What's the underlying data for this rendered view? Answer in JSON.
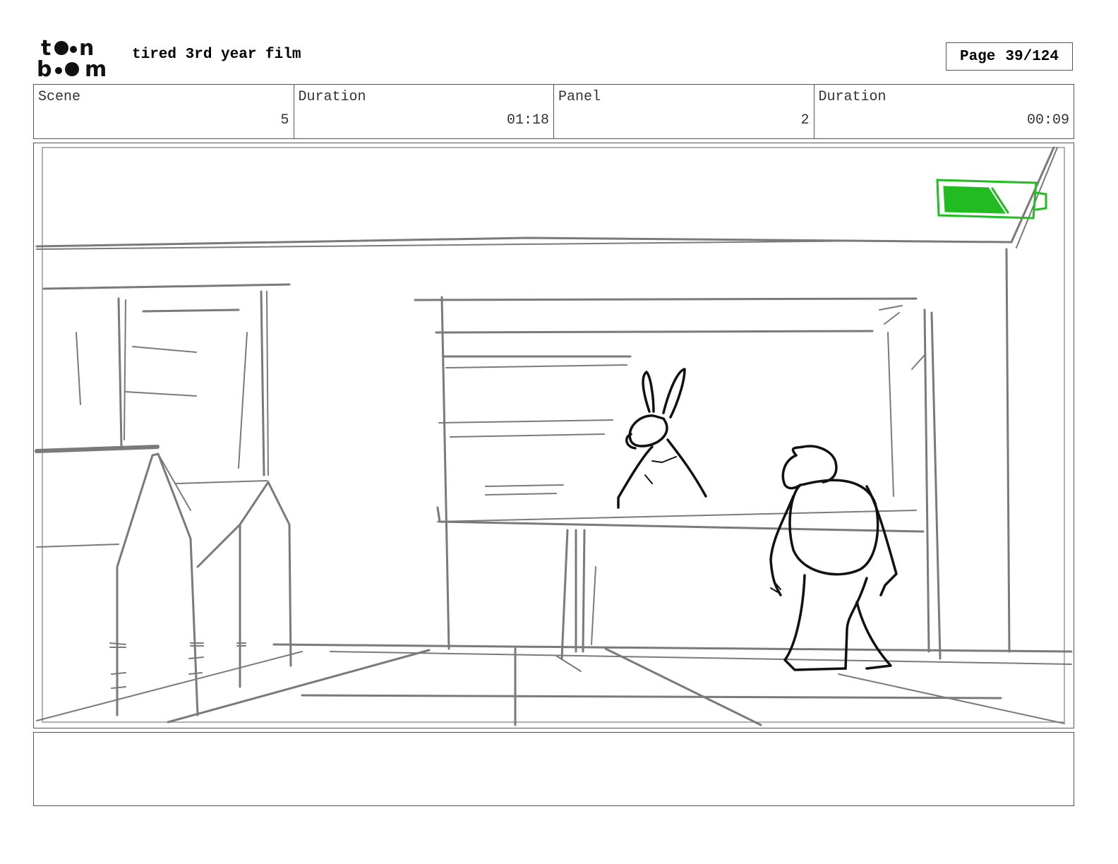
{
  "header": {
    "logo_text": "toon boom",
    "project_title": "tired 3rd year film",
    "page_label": "Page",
    "page_number": "39/124"
  },
  "info": {
    "scene_label": "Scene",
    "scene_value": "5",
    "scene_duration_label": "Duration",
    "scene_duration_value": "01:18",
    "panel_label": "Panel",
    "panel_value": "2",
    "panel_duration_label": "Duration",
    "panel_duration_value": "00:09"
  },
  "panel": {
    "sketch_line_color": "#7a7a7a",
    "character_line_color": "#111111",
    "exit_sign_color": "#22bb22"
  },
  "notes": {
    "text": ""
  }
}
